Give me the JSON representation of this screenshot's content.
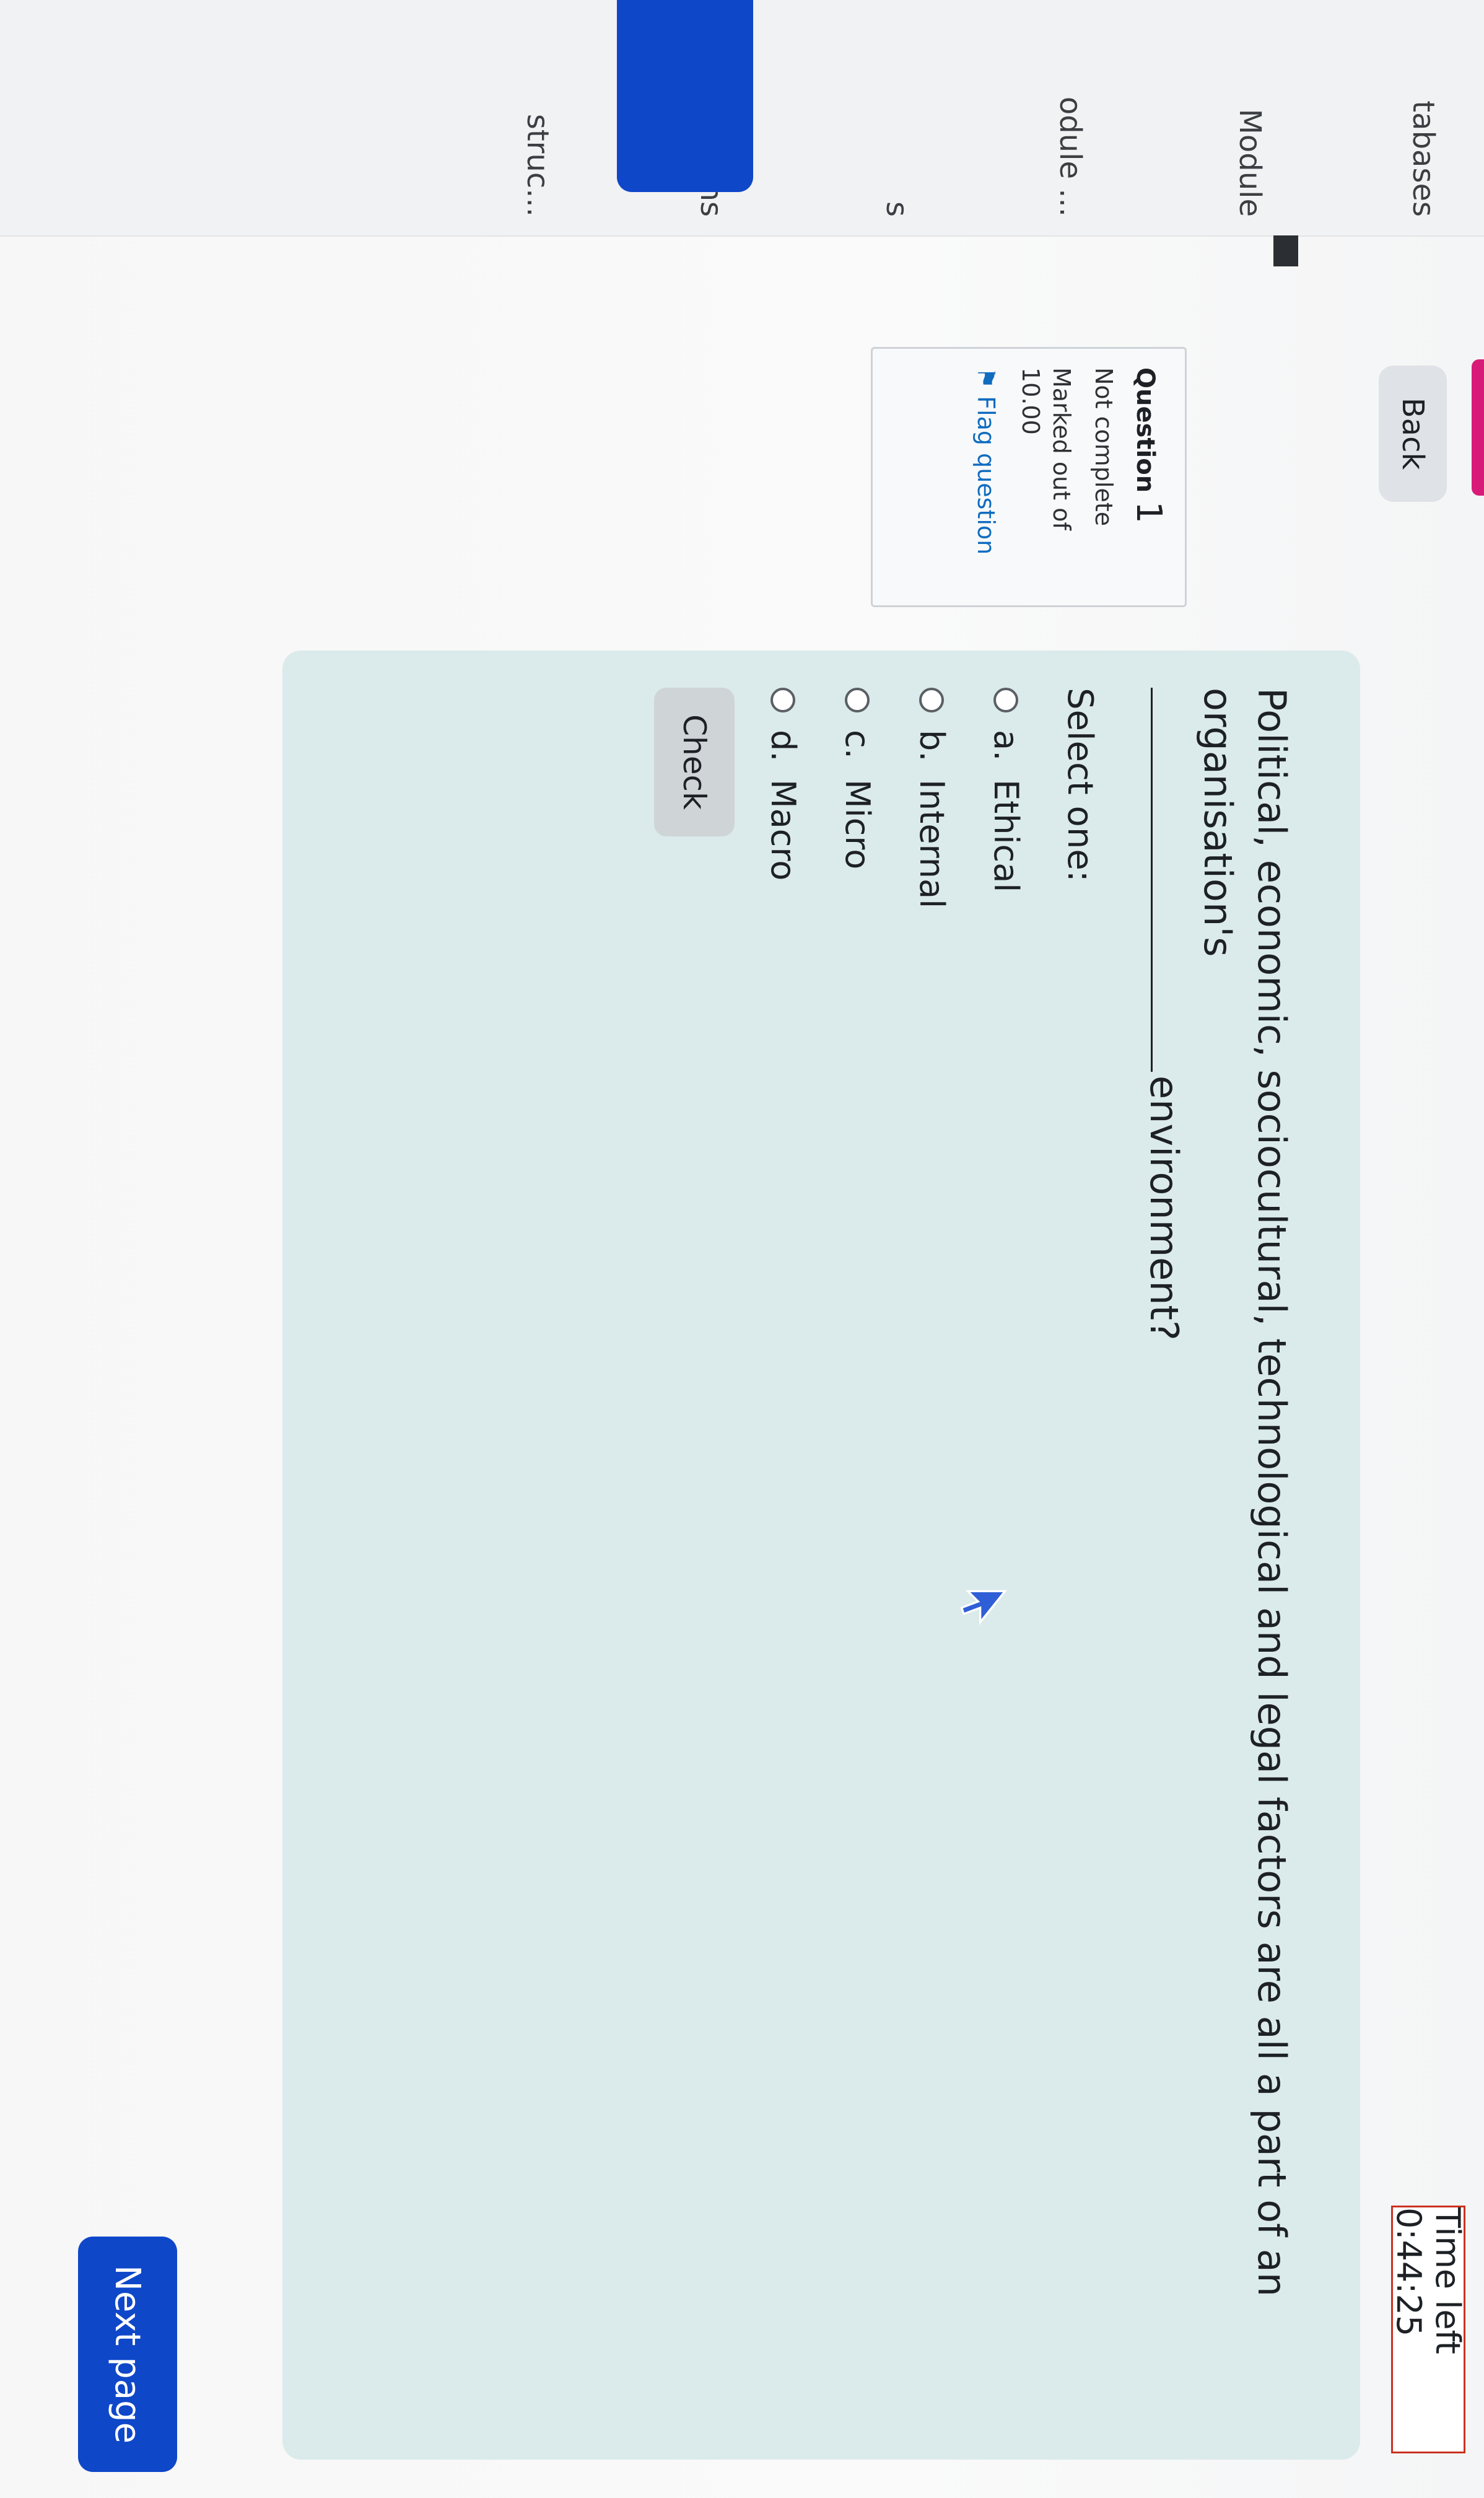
{
  "nav": {
    "items": [
      {
        "label": "tabases"
      },
      {
        "label": "Module"
      },
      {
        "label": "odule ..."
      },
      {
        "label": "s"
      },
      {
        "label": "tions"
      },
      {
        "label": "struc..."
      }
    ]
  },
  "toolbar": {
    "back_label": "Back"
  },
  "timer": {
    "label": "Time left 0:44:25"
  },
  "question_info": {
    "title": "Question",
    "number": "1",
    "status": "Not complete",
    "marked_out_of_label": "Marked out of",
    "marked_out_of_value": "10.00",
    "flag_label": "Flag question"
  },
  "question": {
    "text_part1": "Political, economic, sociocultural, technological and legal factors are all a part of an organisation's",
    "text_part2": "environment?",
    "select_prompt": "Select one:",
    "options": [
      {
        "letter": "a.",
        "label": "Ethical"
      },
      {
        "letter": "b.",
        "label": "Internal"
      },
      {
        "letter": "c.",
        "label": "Micro"
      },
      {
        "letter": "d.",
        "label": "Macro"
      }
    ],
    "check_label": "Check"
  },
  "footer": {
    "next_label": "Next page"
  },
  "colors": {
    "accent": "#0f47c9",
    "panel": "#dbeaea",
    "timer_border": "#ca3120"
  }
}
